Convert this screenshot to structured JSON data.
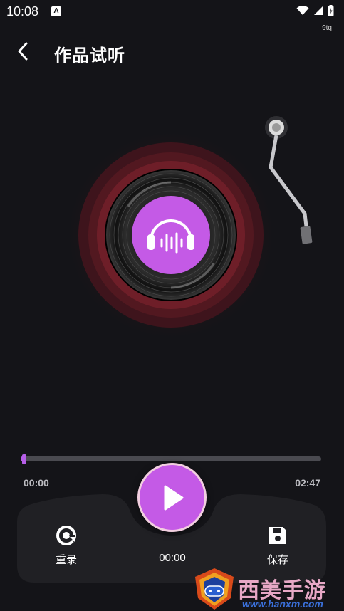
{
  "status_bar": {
    "time": "10:08",
    "notification_icon": "A",
    "sub_label": "9tq",
    "icons": [
      "wifi-icon",
      "signal-icon",
      "battery-icon"
    ]
  },
  "header": {
    "back_icon": "chevron-left-icon",
    "title": "作品试听"
  },
  "player": {
    "disc_icon": "headphones-icon",
    "progress": 0.005,
    "elapsed_label": "00:00",
    "duration_label": "02:47",
    "current_time": "00:00",
    "play_icon": "play-icon"
  },
  "actions": {
    "rerecord_label": "重录",
    "rerecord_icon": "rerecord-icon",
    "save_label": "保存",
    "save_icon": "save-icon"
  },
  "watermark": {
    "title": "西美手游网",
    "url": "www.hanxm.com"
  },
  "colors": {
    "background": "#141418",
    "accent": "#c45ae6",
    "panel": "#202024",
    "ring": "#6e1e28"
  }
}
